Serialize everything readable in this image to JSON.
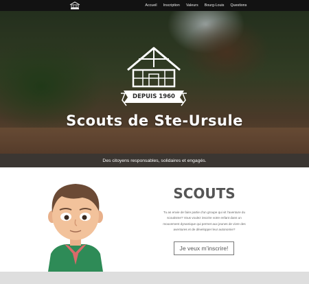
{
  "nav": {
    "items": [
      {
        "label": "Accueil"
      },
      {
        "label": "Inscription"
      },
      {
        "label": "Valeurs"
      },
      {
        "label": "Bourg-Louis"
      },
      {
        "label": "Questions"
      }
    ]
  },
  "hero": {
    "banner_text": "DEPUIS 1960",
    "title": "Scouts de Ste-Ursule"
  },
  "tagline": "Des citoyens responsables, solidaires et engagés.",
  "scouts": {
    "title": "SCOUTS",
    "intro": "Tu as envie de faire partie d'un groupe qui vit l'aventure du scoutisme? Vous voulez inscrire votre enfant dans un mouvement dynamique qui permet aux jeunes de vivre des aventures et de développer leur autonomie?",
    "cta_label": "Je veux m'inscrire!"
  },
  "colors": {
    "topbar": "#121212",
    "tagline_bar": "#3b3632",
    "scout_shirt": "#2e8b57",
    "scarf": "#d96a6a"
  }
}
